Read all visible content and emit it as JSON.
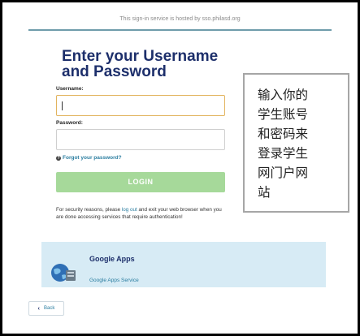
{
  "header": {
    "hosted_text": "This sign-in service is hosted by sso.philasd.org"
  },
  "form": {
    "title": "Enter your Username and Password",
    "username_label": "Username:",
    "username_value": "",
    "password_label": "Password:",
    "password_value": "",
    "forgot_link": "Forgot your password?",
    "login_label": "LOGIN"
  },
  "security": {
    "before": "For security reasons, please ",
    "link": "log out",
    "after": " and exit your web browser when you are done accessing services that require authentication!"
  },
  "service": {
    "title": "Google Apps",
    "subtitle": "Google Apps Service",
    "icon": "globe-computer-icon"
  },
  "nav": {
    "back_label": "Back"
  },
  "annotation": {
    "text": "输入你的\n学生账号\n和密码来\n登录学生\n网门户网\n站"
  },
  "colors": {
    "title": "#1d2f6b",
    "accent_link": "#2a7da0",
    "login_button": "#a6d99a",
    "panel": "#d7ebf5",
    "focus_border": "#e2b45f"
  }
}
